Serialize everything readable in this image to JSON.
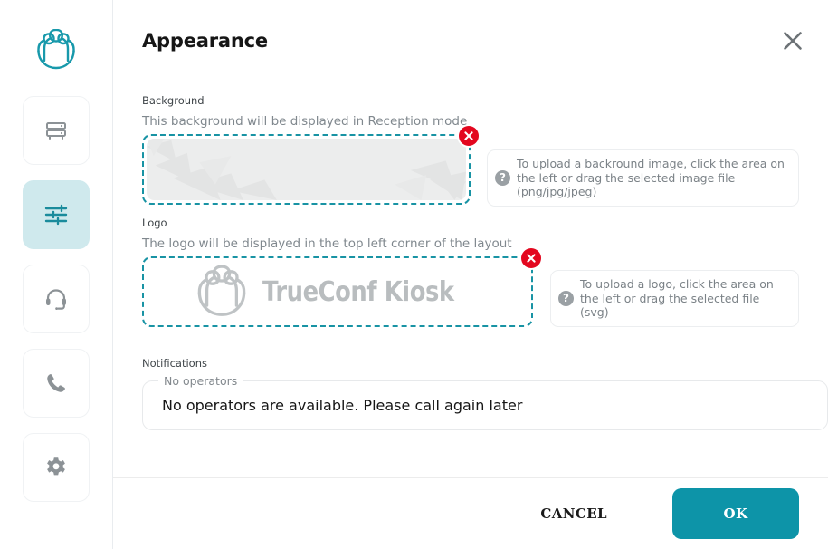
{
  "app": {
    "brand_icon": "people-group-icon"
  },
  "sidebar": {
    "items": [
      {
        "id": "server",
        "icon": "server-rack-icon",
        "active": false
      },
      {
        "id": "appearance",
        "icon": "sliders-icon",
        "active": true
      },
      {
        "id": "operators",
        "icon": "headset-icon",
        "active": false
      },
      {
        "id": "calls",
        "icon": "phone-icon",
        "active": false
      },
      {
        "id": "settings",
        "icon": "gear-icon",
        "active": false
      }
    ]
  },
  "panel": {
    "title": "Appearance",
    "close_icon": "close-icon"
  },
  "background": {
    "label": "Background",
    "description": "This background will be displayed in Reception mode",
    "remove_icon": "remove-circle-icon",
    "hint": "To upload a backround image, click the area on the left or drag the selected image file (png/jpg/jpeg)",
    "hint_icon": "question-mark-icon"
  },
  "logo": {
    "label": "Logo",
    "description": "The logo will be displayed in the top left corner of the layout",
    "preview_text": "TrueConf Kiosk",
    "preview_icon": "people-group-icon",
    "remove_icon": "remove-circle-icon",
    "hint": "To upload a logo, click the area on the left or drag the selected file (svg)",
    "hint_icon": "question-mark-icon"
  },
  "notifications": {
    "label": "Notifications",
    "field_legend": "No operators",
    "field_value": "No operators are available. Please call again later",
    "field_placeholder": "No operators are available. Please call again later"
  },
  "footer": {
    "cancel_label": "CANCEL",
    "ok_label": "OK"
  },
  "colors": {
    "accent": "#0d94a8",
    "accent_soft": "#cfe9ed",
    "danger": "#e3071f",
    "muted": "#80888e"
  }
}
